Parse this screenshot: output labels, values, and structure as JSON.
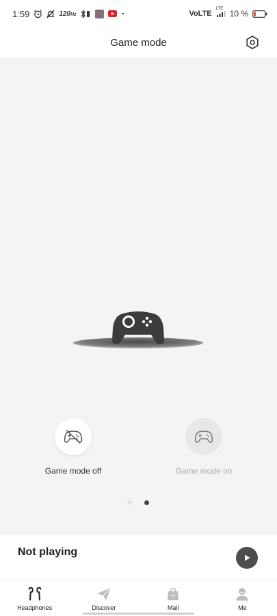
{
  "status_bar": {
    "time": "1:59",
    "refresh_rate": "120",
    "refresh_unit": "Hz",
    "network": "VoLTE",
    "network_type": "LTE",
    "battery_percent": "10 %"
  },
  "header": {
    "title": "Game mode"
  },
  "modes": [
    {
      "label": "Game mode off",
      "selected": true
    },
    {
      "label": "Game mode on",
      "selected": false
    }
  ],
  "pager": {
    "current_page": 2,
    "total_pages": 2
  },
  "player": {
    "status": "Not playing"
  },
  "nav": {
    "items": [
      {
        "label": "Headphones",
        "icon": "headphones-icon"
      },
      {
        "label": "Discover",
        "icon": "paper-plane-icon"
      },
      {
        "label": "Mall",
        "icon": "shopping-bag-icon"
      },
      {
        "label": "Me",
        "icon": "profile-icon"
      }
    ]
  },
  "colors": {
    "battery_low": "#e53935",
    "youtube": "#e32020",
    "controller": "#3c3c3c",
    "play_button": "#4d4d4d"
  }
}
